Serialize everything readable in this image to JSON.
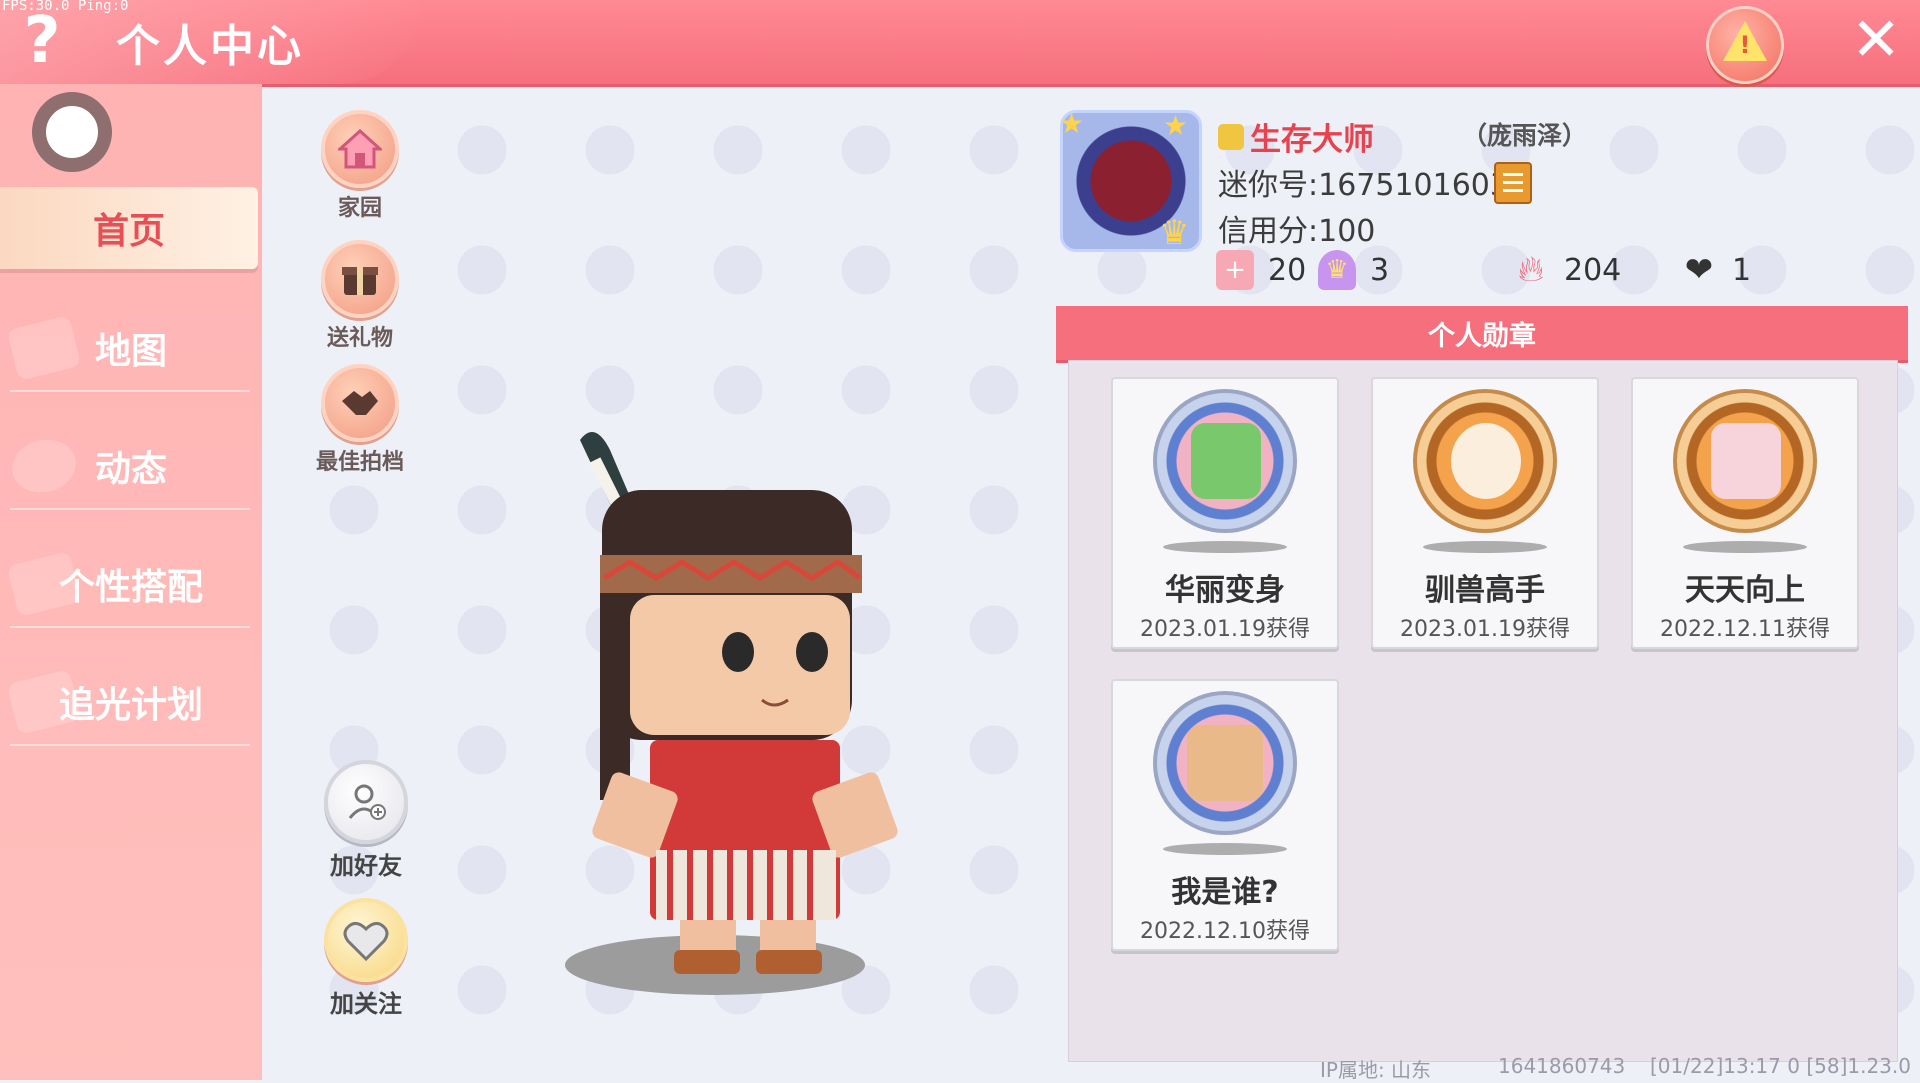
{
  "debug": {
    "fps": "FPS:30.0  Ping:0"
  },
  "header": {
    "help": "?",
    "title": "个人中心",
    "close": "✕",
    "warn": "!"
  },
  "sidebar": {
    "items": [
      {
        "label": "首页",
        "active": true
      },
      {
        "label": "地图"
      },
      {
        "label": "动态"
      },
      {
        "label": "个性搭配"
      },
      {
        "label": "追光计划"
      }
    ]
  },
  "actions": {
    "home": "家园",
    "gift": "送礼物",
    "photo": "最佳拍档",
    "add_friend": "加好友",
    "follow": "加关注"
  },
  "profile": {
    "title": "生存大师",
    "realname": "（庞雨泽）",
    "mini_id": "迷你号:1675101603",
    "credit": "信用分:100",
    "stats": [
      {
        "icon": "plus-badge-icon",
        "value": "20",
        "color": "#f09aa8"
      },
      {
        "icon": "trophy-icon",
        "value": "3",
        "color": "#c27be6"
      },
      {
        "icon": "flame-icon",
        "value": "204",
        "color": "#f06a7a"
      },
      {
        "icon": "hearts-icon",
        "value": "1",
        "color": "#333333"
      }
    ]
  },
  "medals": {
    "header": "个人勋章",
    "items": [
      {
        "name": "华丽变身",
        "date": "2023.01.19获得",
        "style": "silver"
      },
      {
        "name": "驯兽高手",
        "date": "2023.01.19获得",
        "style": "gold"
      },
      {
        "name": "天天向上",
        "date": "2022.12.11获得",
        "style": "gold"
      },
      {
        "name": "我是谁?",
        "date": "2022.12.10获得",
        "style": "silver"
      }
    ]
  },
  "footer": {
    "ip": "IP属地: 山东",
    "uid": "1641860743",
    "build": "[01/22]13:17 0  [58]1.23.0"
  },
  "colors": {
    "accent": "#f66f7d",
    "sidebar": "#ffb8b8",
    "title_red": "#e8424e"
  }
}
